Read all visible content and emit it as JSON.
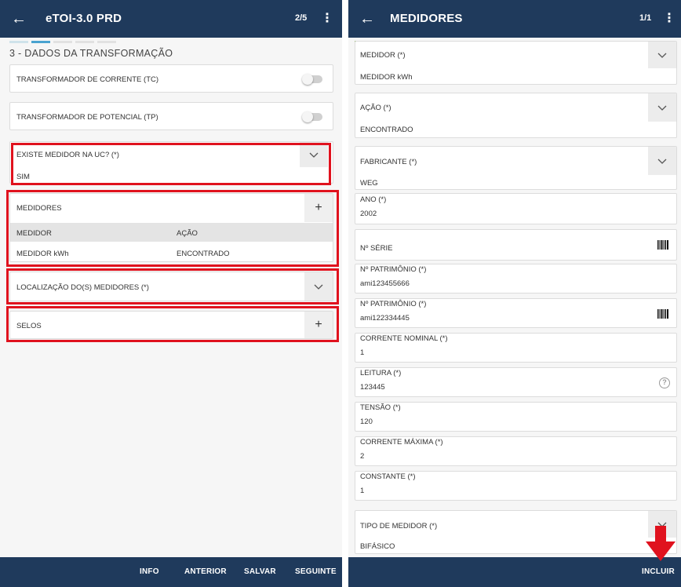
{
  "left": {
    "appbar": {
      "back_icon": "arrow-left-icon",
      "title": "eTOI-3.0 PRD",
      "pager": "2/5",
      "menu_icon": "kebab-icon"
    },
    "step_progress_colors": [
      "#cfe3ea",
      "#4aa3d0",
      "#d9d9d9",
      "#d9d9d9",
      "#d9d9d9"
    ],
    "section_title": "3 - DADOS DA TRANSFORMAÇÃO",
    "tc_label": "TRANSFORMADOR DE CORRENTE (TC)",
    "tp_label": "TRANSFORMADOR DE POTENCIAL (TP)",
    "existe_medidor": {
      "label": "EXISTE MEDIDOR NA UC? (*)",
      "value": "SIM"
    },
    "medidores": {
      "label": "MEDIDORES",
      "columns": [
        "MEDIDOR",
        "AÇÃO"
      ],
      "rows": [
        {
          "medidor": "MEDIDOR kWh",
          "acao": "ENCONTRADO"
        }
      ]
    },
    "localizacao_label": "LOCALIZAÇÃO DO(S) MEDIDORES (*)",
    "selos_label": "SELOS",
    "bottom": {
      "info": "INFO",
      "anterior": "ANTERIOR",
      "salvar": "SALVAR",
      "seguinte": "SEGUINTE"
    }
  },
  "right": {
    "appbar": {
      "back_icon": "arrow-left-icon",
      "title": "MEDIDORES",
      "pager": "1/1",
      "menu_icon": "kebab-icon"
    },
    "accent_color": "#7cb342",
    "fields": {
      "medidor": {
        "label": "MEDIDOR (*)",
        "value": "MEDIDOR kWh"
      },
      "acao": {
        "label": "AÇÃO (*)",
        "value": "ENCONTRADO"
      },
      "fabricante": {
        "label": "FABRICANTE (*)",
        "value": "WEG"
      },
      "ano": {
        "label": "ANO (*)",
        "value": "2002"
      },
      "serie": {
        "label": "Nº SÉRIE",
        "value": ""
      },
      "patrimonio1": {
        "label": "Nº PATRIMÔNIO (*)",
        "value": "ami123455666"
      },
      "patrimonio2": {
        "label": "Nº PATRIMÔNIO (*)",
        "value": "ami122334445"
      },
      "corrente_nominal": {
        "label": "CORRENTE NOMINAL (*)",
        "value": "1"
      },
      "leitura": {
        "label": "LEITURA (*)",
        "value": "123445"
      },
      "tensao": {
        "label": "TENSÃO (*)",
        "value": "120"
      },
      "corrente_maxima": {
        "label": "CORRENTE MÁXIMA (*)",
        "value": "2"
      },
      "constante": {
        "label": "CONSTANTE (*)",
        "value": "1"
      },
      "tipo_medidor": {
        "label": "TIPO DE MEDIDOR (*)",
        "value": "BIFÁSICO"
      }
    },
    "bottom": {
      "incluir": "INCLUIR"
    }
  },
  "annotations": {
    "highlight_color": "#e0121e",
    "arrow_icon": "arrow-down-icon"
  }
}
